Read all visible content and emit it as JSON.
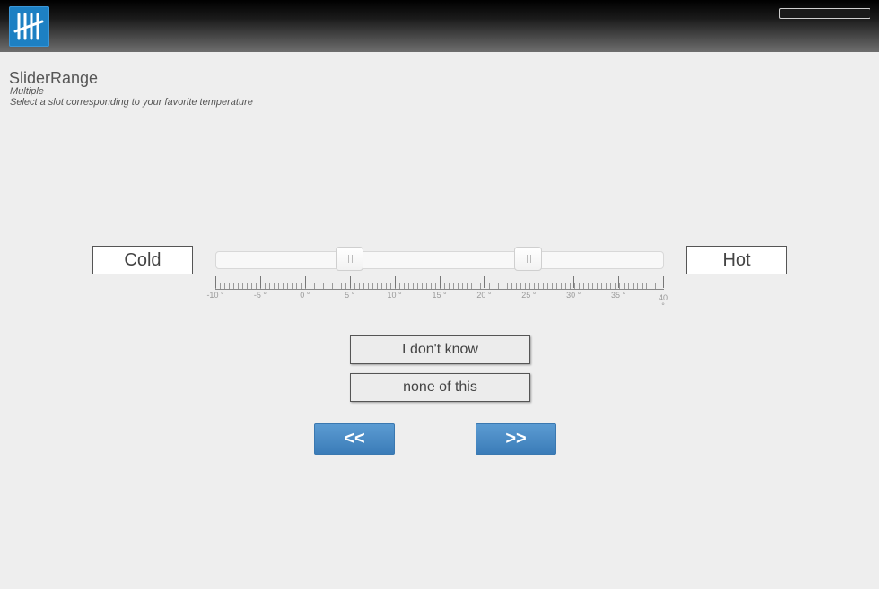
{
  "question": {
    "title": "SliderRange",
    "type": "Multiple",
    "instruction": "Select a slot corresponding to your favorite temperature"
  },
  "labels": {
    "left": "Cold",
    "right": "Hot"
  },
  "slider": {
    "min": -10,
    "max": 40,
    "low_value": 5,
    "high_value": 25,
    "ticks": [
      "-10 °",
      "-5 °",
      "0 °",
      "5 °",
      "10 °",
      "15 °",
      "20 °",
      "25 °",
      "30 °",
      "35 °"
    ],
    "end_tick": "40",
    "end_tick_unit": "°"
  },
  "options": [
    "I don't know",
    "none of this"
  ],
  "nav": {
    "prev": "<<",
    "next": ">>"
  },
  "colors": {
    "accent": "#4a8cc6",
    "logo": "#1d80c3"
  },
  "icons": {
    "logo": "tally-marks-icon"
  }
}
